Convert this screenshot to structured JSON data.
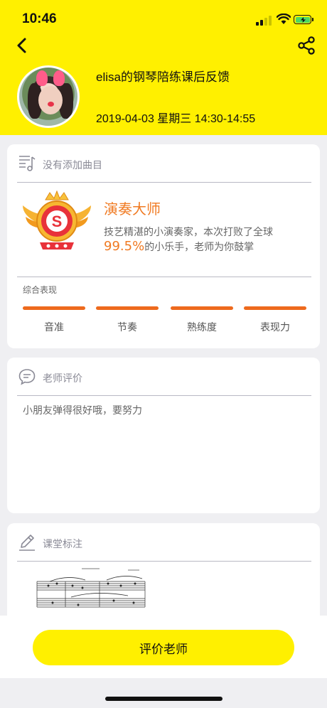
{
  "status_bar": {
    "time": "10:46"
  },
  "header": {
    "title": "elisa的钢琴陪练课后反馈",
    "datetime": "2019-04-03 星期三 14:30-14:55",
    "back_icon": "chevron-left-icon",
    "share_icon": "share-icon"
  },
  "pieces_card": {
    "header_label": "没有添加曲目",
    "achievement": {
      "title": "演奏大师",
      "line1": "技艺精湛的小演奏家，本次打败了全球",
      "percent": "99.5%",
      "line2_suffix": "的小乐手，老师为你鼓掌"
    },
    "performance_label": "综合表现",
    "metrics": [
      {
        "label": "音准",
        "level": 1.0
      },
      {
        "label": "节奏",
        "level": 1.0
      },
      {
        "label": "熟练度",
        "level": 1.0
      },
      {
        "label": "表现力",
        "level": 1.0
      }
    ]
  },
  "comment_card": {
    "header_label": "老师评价",
    "comment": "小朋友弹得很好哦，要努力"
  },
  "notes_card": {
    "header_label": "课堂标注"
  },
  "footer": {
    "button_label": "评价老师"
  },
  "colors": {
    "brand_yellow": "#fff000",
    "accent_orange": "#f07a22",
    "bar_orange": "#ee6a1d"
  }
}
